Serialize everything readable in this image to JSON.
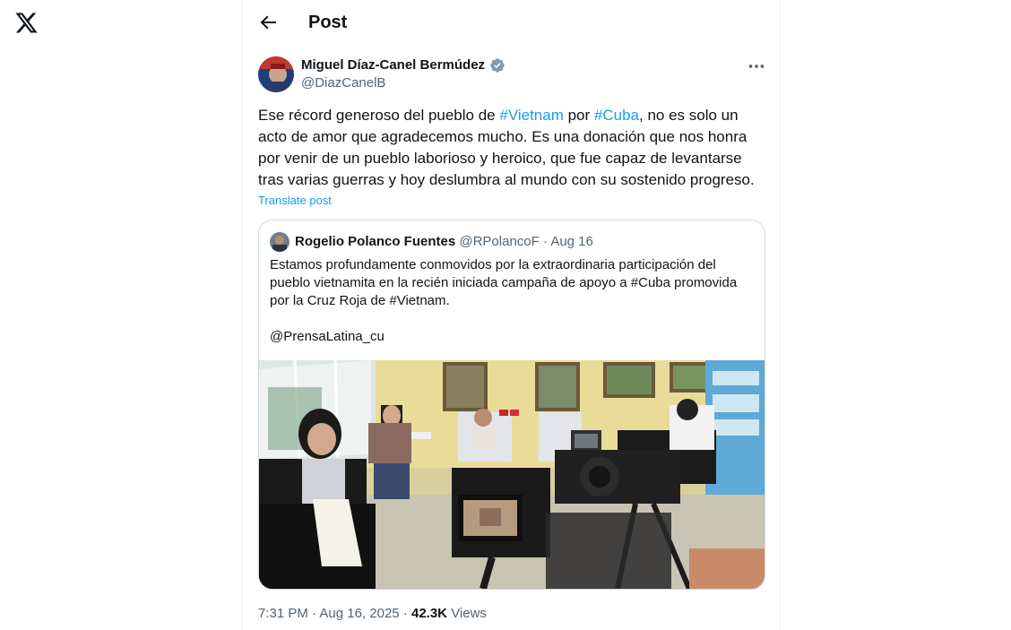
{
  "nav": {
    "logo_icon": "x-logo-icon"
  },
  "header": {
    "back_icon": "arrow-left-icon",
    "title": "Post"
  },
  "post": {
    "author": {
      "name": "Miguel Díaz-Canel Bermúdez",
      "handle": "@DiazCanelB",
      "verified": true
    },
    "text": {
      "part1": "Ese récord generoso del pueblo de ",
      "hashtag1": "#Vietnam",
      "part2": " por ",
      "hashtag2": "#Cuba",
      "part3": ", no es solo un acto de amor que agradecemos mucho. Es una donación que nos honra por venir de un pueblo laborioso y heroico, que fue capaz de levantarse tras varias guerras y hoy deslumbra al mundo con su sostenido progreso."
    },
    "translate_label": "Translate post",
    "quote": {
      "name": "Rogelio Polanco Fuentes",
      "handle": "@RPolancoF",
      "separator": "·",
      "date": "Aug 16",
      "text": "Estamos profundamente conmovidos por la extraordinaria participación del pueblo vietnamita en la recién iniciada campaña de apoyo a #Cuba promovida por la Cruz Roja de #Vietnam.",
      "mention": "@PrensaLatina_cu"
    },
    "meta": {
      "time": "7:31 PM",
      "separator": "·",
      "date": "Aug 16, 2025",
      "views_count": "42.3K",
      "views_label": "Views"
    }
  },
  "colors": {
    "accent": "#1d9bf0",
    "text_primary": "#0f1419",
    "text_secondary": "#536471",
    "border": "#cfd9de"
  }
}
